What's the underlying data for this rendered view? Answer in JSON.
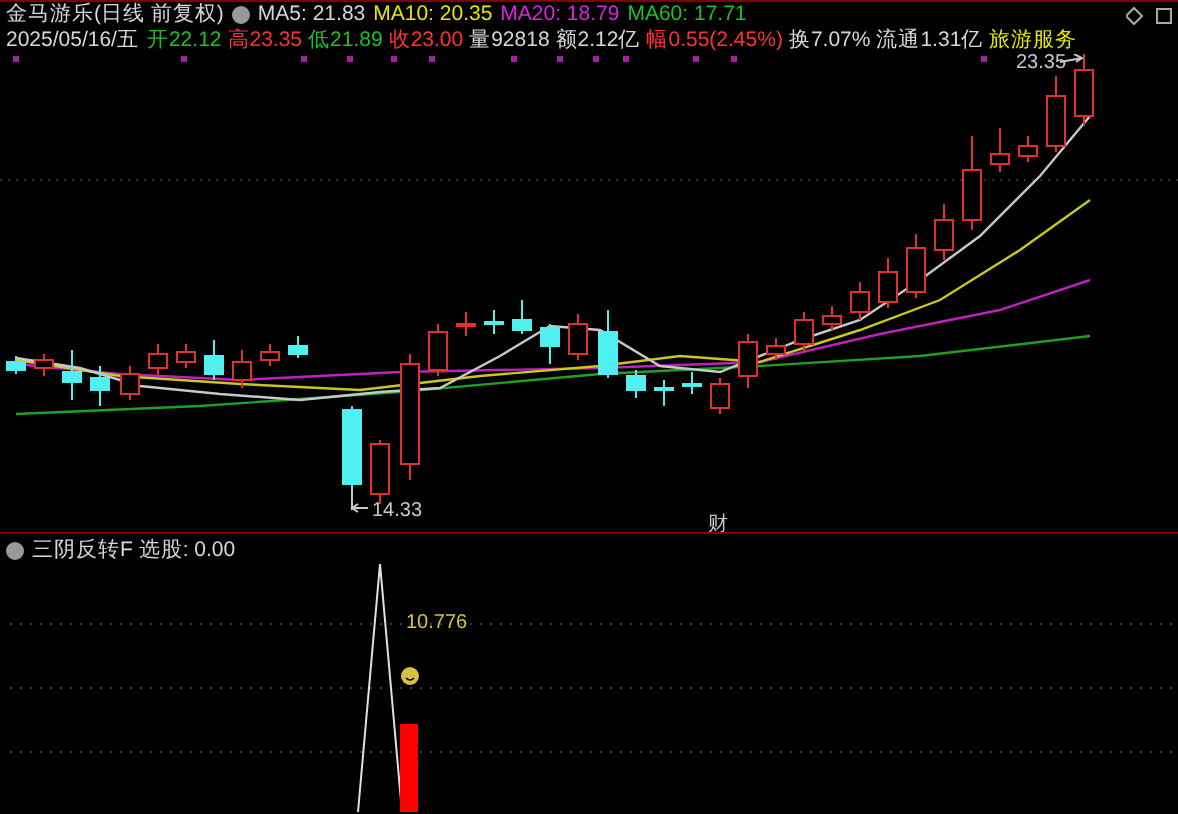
{
  "header": {
    "title": "金马游乐(日线 前复权)",
    "moving_averages": [
      {
        "label": "MA5: 21.83",
        "color": "#d8d8d8"
      },
      {
        "label": "MA10: 20.35",
        "color": "#e6e600"
      },
      {
        "label": "MA20: 18.79",
        "color": "#e020e0"
      },
      {
        "label": "MA60: 17.71",
        "color": "#20c020"
      }
    ]
  },
  "quote": {
    "date": "2025/05/16/五",
    "fields": [
      {
        "label": "开",
        "value": "22.12",
        "color": "#20c020"
      },
      {
        "label": "高",
        "value": "23.35",
        "color": "#ff3232"
      },
      {
        "label": "低",
        "value": "21.89",
        "color": "#20c020"
      },
      {
        "label": "收",
        "value": "23.00",
        "color": "#ff3232"
      },
      {
        "label": "量",
        "value": "92818",
        "color": "#d8d8d8"
      },
      {
        "label": "额",
        "value": "2.12亿",
        "color": "#d8d8d8"
      },
      {
        "label": "幅",
        "value": "0.55(2.45%)",
        "color": "#ff3232"
      },
      {
        "label": "换",
        "value": "7.07%",
        "color": "#d8d8d8"
      },
      {
        "label": "流通",
        "value": "1.31亿",
        "color": "#d8d8d8"
      }
    ],
    "sector": "旅游服务"
  },
  "price_chart": {
    "high_label": "23.35",
    "low_label": "14.33",
    "event_mark": "财"
  },
  "indicator_panel": {
    "title": "三阴反转F  选股: 0.00",
    "value_label": "10.776"
  }
}
